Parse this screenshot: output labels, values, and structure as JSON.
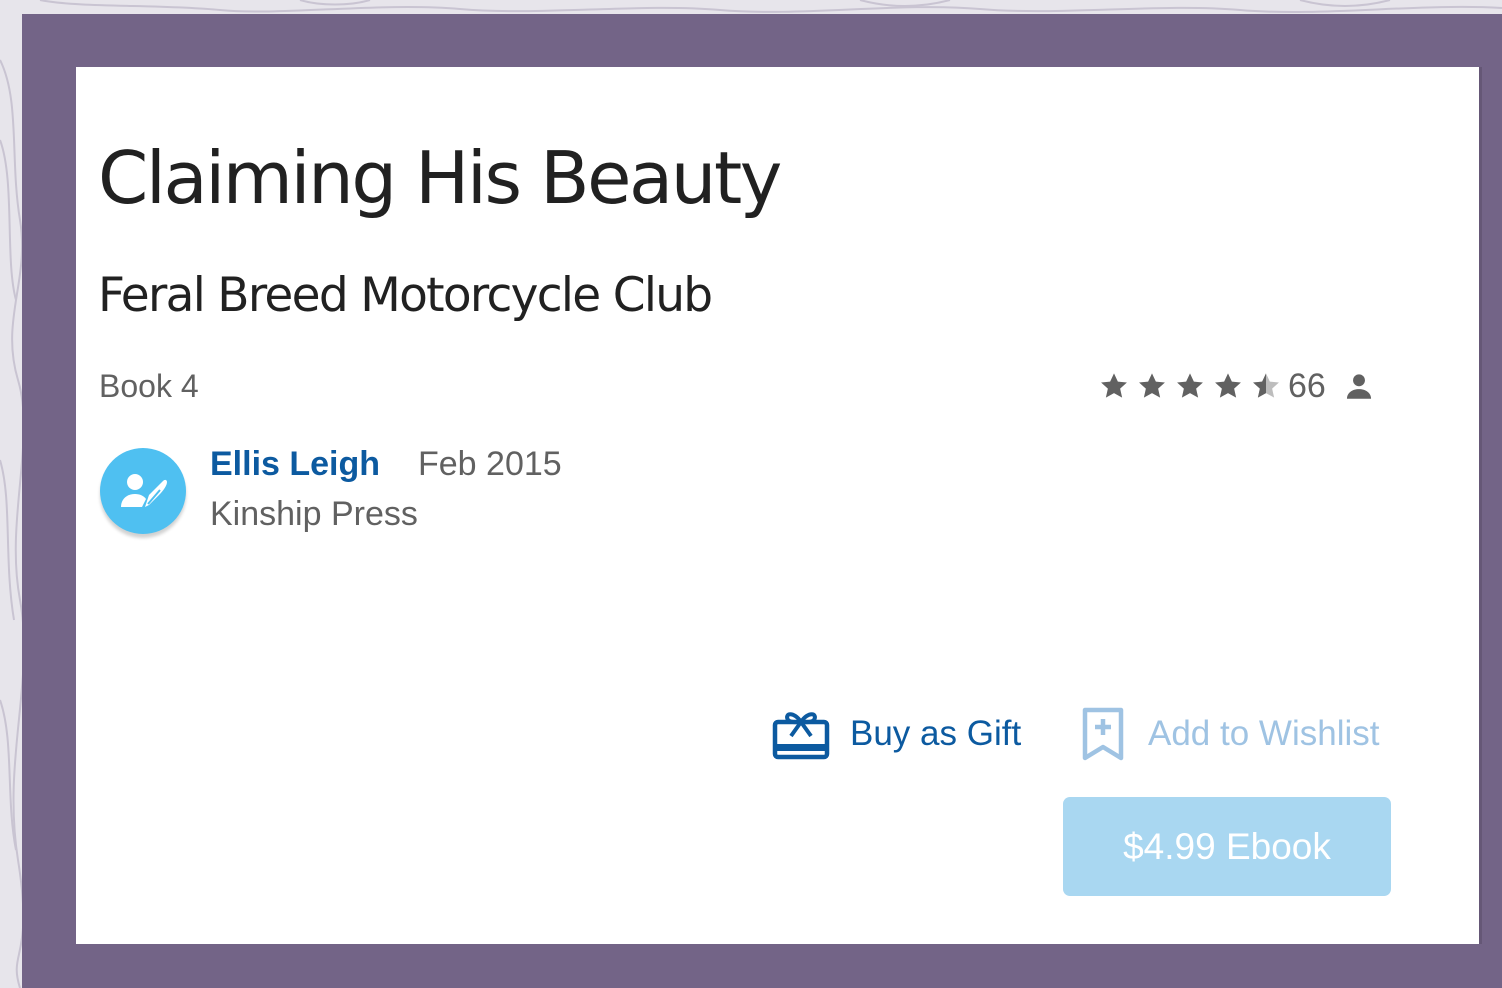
{
  "book": {
    "title": "Claiming His Beauty",
    "series": "Feral Breed Motorcycle Club",
    "book_number": "Book 4"
  },
  "rating": {
    "stars": 4.5,
    "max_stars": 5,
    "count": "66",
    "icon": "person-icon"
  },
  "author": {
    "name": "Ellis Leigh",
    "date": "Feb 2015",
    "publisher": "Kinship Press",
    "avatar_icon": "author-quill-icon"
  },
  "actions": {
    "gift_label": "Buy as Gift",
    "gift_icon": "gift-card-icon",
    "wishlist_label": "Add to Wishlist",
    "wishlist_icon": "bookmark-add-icon",
    "buy_label": "$4.99 Ebook"
  },
  "colors": {
    "frame": "#736487",
    "link_blue": "#0c5aa0",
    "avatar_blue": "#4fc0f1",
    "wishlist_muted": "#9fc3e3",
    "buy_button": "#a9d7f1",
    "star_gray": "#616161"
  }
}
